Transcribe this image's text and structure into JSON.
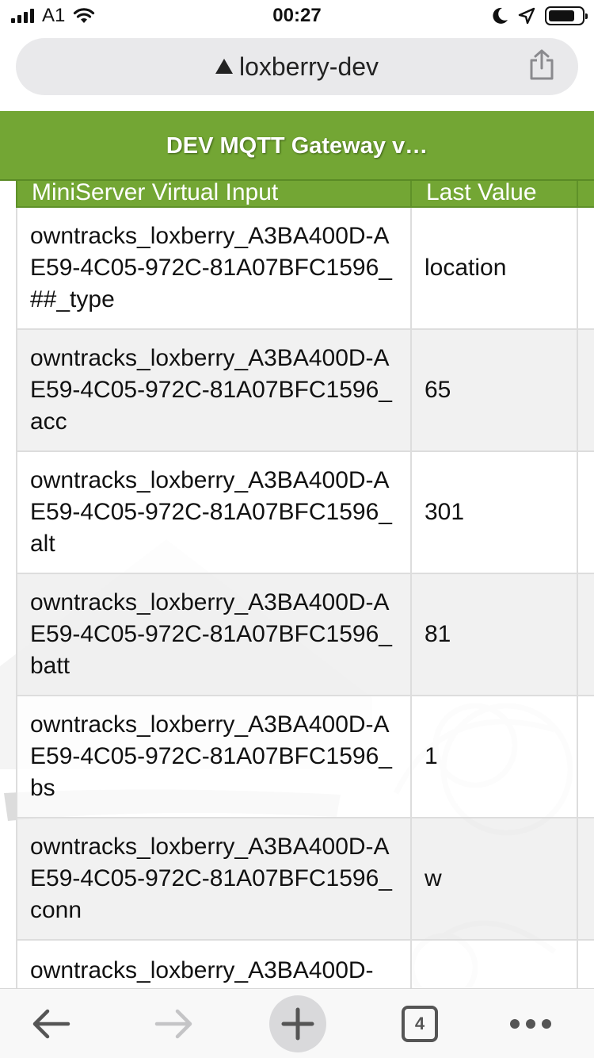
{
  "status_bar": {
    "carrier": "A1",
    "time": "00:27"
  },
  "url_bar": {
    "url": "loxberry-dev"
  },
  "app": {
    "title": "DEV MQTT Gateway v…",
    "accent_color": "#73a634"
  },
  "table": {
    "columns": [
      "MiniServer Virtual Input",
      "Last Value"
    ],
    "rows": [
      {
        "input": "owntracks_loxberry_A3BA400D-AE59-4C05-972C-81A07BFC1596_##_type",
        "value": "location"
      },
      {
        "input": "owntracks_loxberry_A3BA400D-AE59-4C05-972C-81A07BFC1596_acc",
        "value": "65"
      },
      {
        "input": "owntracks_loxberry_A3BA400D-AE59-4C05-972C-81A07BFC1596_alt",
        "value": "301"
      },
      {
        "input": "owntracks_loxberry_A3BA400D-AE59-4C05-972C-81A07BFC1596_batt",
        "value": "81"
      },
      {
        "input": "owntracks_loxberry_A3BA400D-AE59-4C05-972C-81A07BFC1596_bs",
        "value": "1"
      },
      {
        "input": "owntracks_loxberry_A3BA400D-AE59-4C05-972C-81A07BFC1596_conn",
        "value": "w"
      },
      {
        "input": "owntracks_loxberry_A3BA400D-",
        "value": ""
      }
    ]
  },
  "toolbar": {
    "tab_count": "4"
  }
}
